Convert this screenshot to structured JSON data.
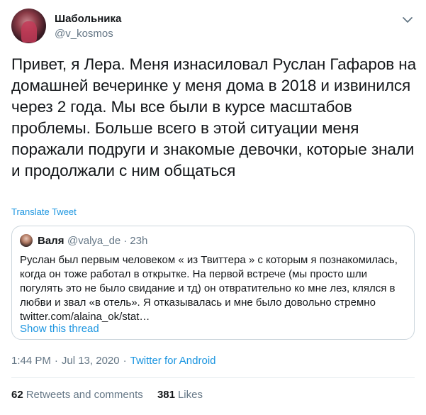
{
  "author": {
    "name": "Шабольника",
    "handle": "@v_kosmos"
  },
  "tweet_text": "Привет, я Лера. Меня изнасиловал Руслан Гафаров на домашней вечеринке у меня дома в 2018 и извинился через 2 года. Мы все были в курсе масштабов проблемы. Больше всего в этой ситуации меня поражали подруги и знакомые девочки, которые знали и продолжали с ним общаться",
  "translate_label": "Translate Tweet",
  "quoted": {
    "name": "Валя",
    "handle": "@valya_de",
    "dot": "·",
    "time": "23h",
    "text": "Руслан был первым человеком « из Твиттера » с которым я познакомилась, когда он тоже работал в открытке. На первой встрече (мы просто шли погулять это не было свидание и тд) он отвратительно ко мне лез, клялся в любви и звал «в отель». Я отказывалась и мне было довольно стремно twitter.com/alaina_ok/stat…",
    "show_thread": "Show this thread"
  },
  "meta": {
    "time": "1:44 PM",
    "dot1": "·",
    "date": "Jul 13, 2020",
    "dot2": "·",
    "source": "Twitter for Android"
  },
  "stats": {
    "retweets_count": "62",
    "retweets_label": "Retweets and comments",
    "likes_count": "381",
    "likes_label": "Likes"
  },
  "colors": {
    "link": "#1b95e0",
    "muted": "#657786",
    "text": "#14171a",
    "border": "#ccd6dd"
  }
}
